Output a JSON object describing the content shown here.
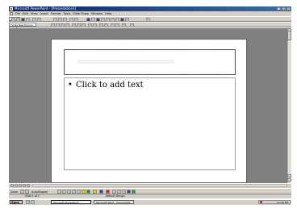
{
  "window": {
    "title": "Microsoft PowerPoint - [Presentation1]",
    "controls": [
      "_",
      "□",
      "×"
    ]
  },
  "menubar": {
    "items": [
      "File",
      "Edit",
      "View",
      "Insert",
      "Format",
      "Tools",
      "Slide Show",
      "Window",
      "Help"
    ]
  },
  "toolbar": {
    "font_name": "Times New Roman",
    "font_size": "24",
    "zoom": "75%"
  },
  "slide": {
    "title_placeholder": "Click to add title",
    "body_placeholder": "Click to add text",
    "bullet": "•"
  },
  "drawing_toolbar": {
    "draw_label": "Draw",
    "autoshapes_label": "AutoShapes"
  },
  "statusbar": {
    "slide_indicator": "Slide 1 of 1",
    "template": "Default Design"
  },
  "taskbar": {
    "start_label": "Start",
    "tasks": [
      "Microsoft PowerPoint...",
      "Microsoft Word - Document1"
    ],
    "clock": "12:00 PM"
  },
  "colors": {
    "titlebar_start": "#0a246a",
    "titlebar_end": "#3a6ea5",
    "chrome": "#d4d0c8",
    "workspace": "#808080"
  }
}
